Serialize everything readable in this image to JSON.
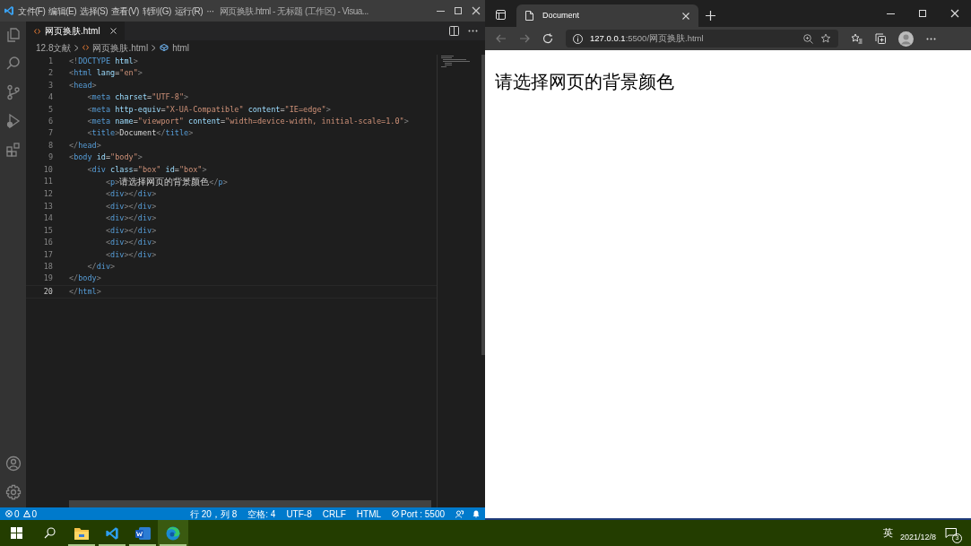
{
  "vscode": {
    "menu": [
      "文件(F)",
      "编辑(E)",
      "选择(S)",
      "查看(V)",
      "转到(G)",
      "运行(R)",
      "···"
    ],
    "window_title": "网页换肤.html - 无标题 (工作区) - Visua...",
    "tabs": [
      {
        "label": "网页换肤.html",
        "selected": true
      }
    ],
    "breadcrumbs": [
      "12.8文献",
      "网页换肤.html",
      "html"
    ],
    "code_lines": [
      {
        "number": "1",
        "current": false,
        "text": "<!DOCTYPE html>"
      },
      {
        "number": "2",
        "current": false,
        "text": "<html lang=\"en\">"
      },
      {
        "number": "3",
        "current": false,
        "text": "<head>"
      },
      {
        "number": "4",
        "current": false,
        "text": "    <meta charset=\"UTF-8\">"
      },
      {
        "number": "5",
        "current": false,
        "text": "    <meta http-equiv=\"X-UA-Compatible\" content=\"IE=edge\">"
      },
      {
        "number": "6",
        "current": false,
        "text": "    <meta name=\"viewport\" content=\"width=device-width, initial-scale=1.0\">"
      },
      {
        "number": "7",
        "current": false,
        "text": "    <title>Document</title>"
      },
      {
        "number": "8",
        "current": false,
        "text": "</head>"
      },
      {
        "number": "9",
        "current": false,
        "text": "<body id=\"body\">"
      },
      {
        "number": "10",
        "current": false,
        "text": "    <div class=\"box\" id=\"box\">"
      },
      {
        "number": "11",
        "current": false,
        "text": "        <p>请选择网页的背景颜色</p>"
      },
      {
        "number": "12",
        "current": false,
        "text": "        <div></div>"
      },
      {
        "number": "13",
        "current": false,
        "text": "        <div></div>"
      },
      {
        "number": "14",
        "current": false,
        "text": "        <div></div>"
      },
      {
        "number": "15",
        "current": false,
        "text": "        <div></div>"
      },
      {
        "number": "16",
        "current": false,
        "text": "        <div></div>"
      },
      {
        "number": "17",
        "current": false,
        "text": "        <div></div>"
      },
      {
        "number": "18",
        "current": false,
        "text": "    </div>"
      },
      {
        "number": "19",
        "current": false,
        "text": "</body>"
      },
      {
        "number": "20",
        "current": true,
        "text": "</html>"
      }
    ],
    "status_bar": {
      "errors": "0",
      "warnings": "0",
      "items": [
        "行 20，列 8",
        "空格: 4",
        "UTF-8",
        "CRLF",
        "HTML"
      ],
      "port": "Port : 5500"
    }
  },
  "browser": {
    "tab": {
      "label": "Document",
      "selected": true
    },
    "address": {
      "host": "127.0.0.1",
      "rest": ":5500/网页换肤.html"
    },
    "page_text": "请选择网页的背景颜色"
  },
  "taskbar": {
    "apps": [
      {
        "kind": "explorer",
        "selected": false
      },
      {
        "kind": "vscode",
        "selected": false
      },
      {
        "kind": "word",
        "selected": false
      },
      {
        "kind": "edge",
        "selected": true
      }
    ],
    "ime": "英",
    "date": "2021/12/8",
    "badge": "3"
  }
}
